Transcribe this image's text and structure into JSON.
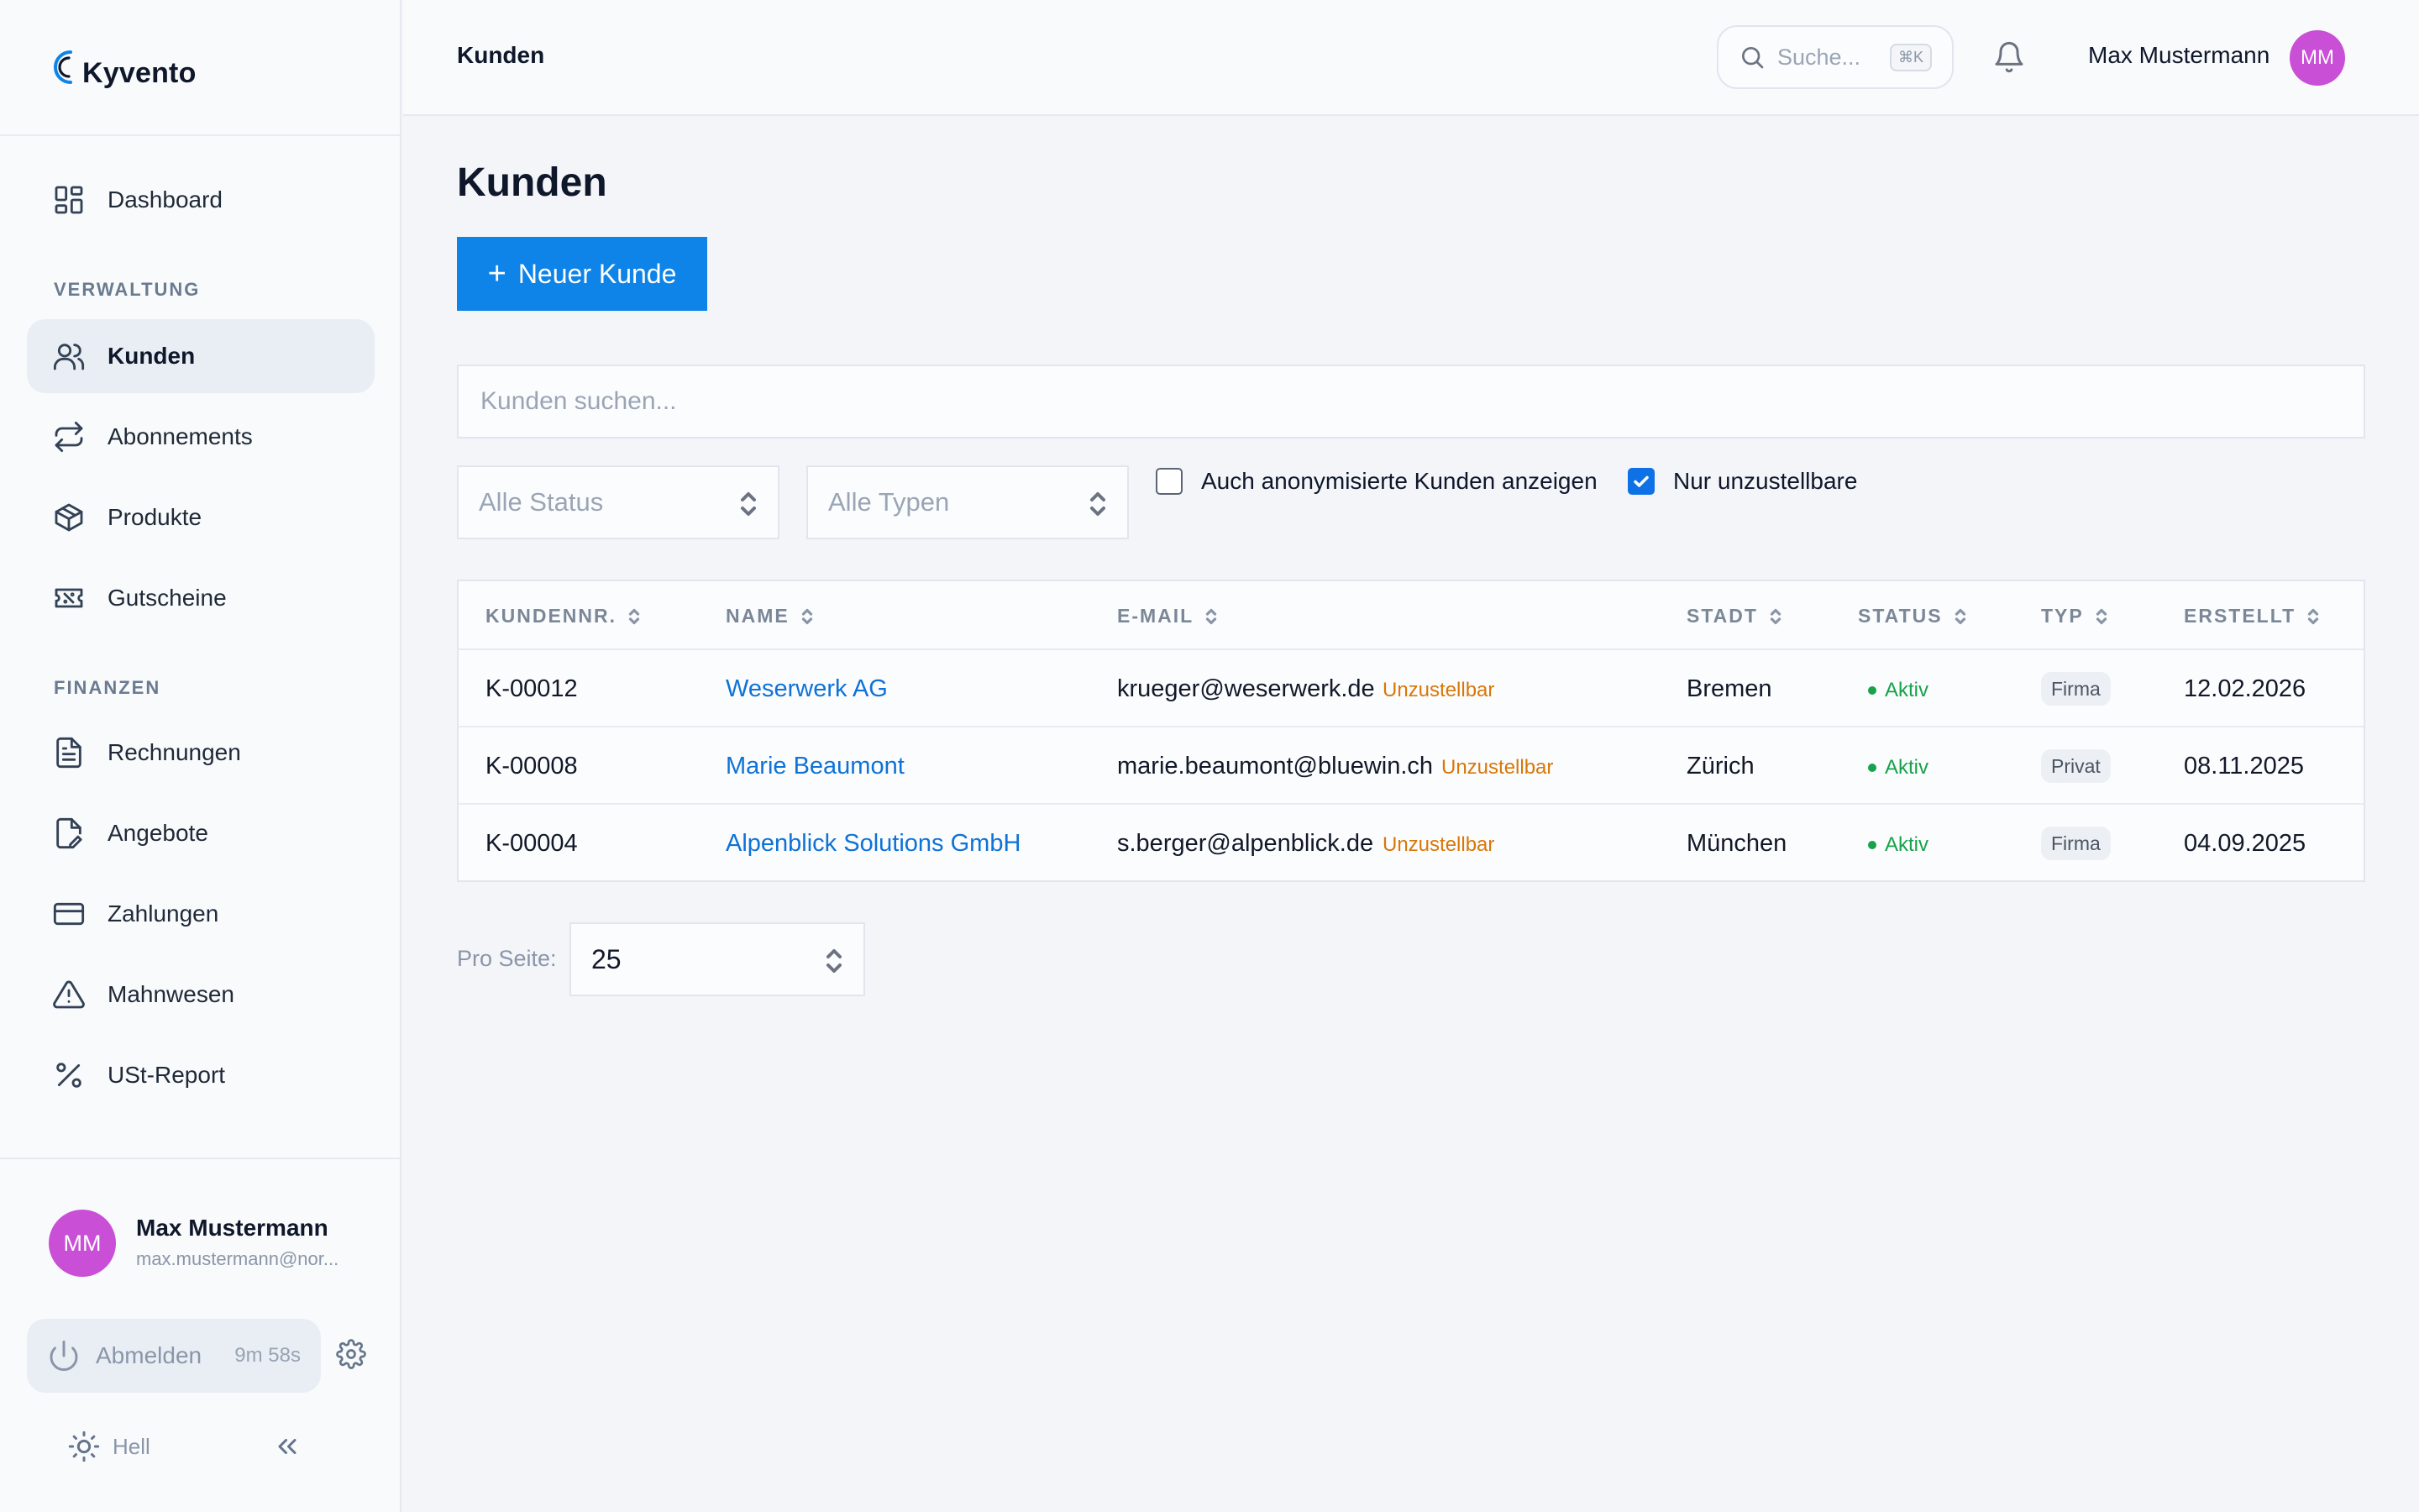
{
  "app": {
    "logo_text": "Kyvento"
  },
  "sidebar": {
    "dashboard": "Dashboard",
    "section_verwaltung": "VERWALTUNG",
    "kunden": "Kunden",
    "abonnements": "Abonnements",
    "produkte": "Produkte",
    "gutscheine": "Gutscheine",
    "section_finanzen": "FINANZEN",
    "rechnungen": "Rechnungen",
    "angebote": "Angebote",
    "zahlungen": "Zahlungen",
    "mahnwesen": "Mahnwesen",
    "ust_report": "USt-Report",
    "user": {
      "initials": "MM",
      "name": "Max Mustermann",
      "email": "max.mustermann@nor..."
    },
    "logout_label": "Abmelden",
    "logout_timer": "9m 58s",
    "theme_label": "Hell"
  },
  "topbar": {
    "breadcrumb": "Kunden",
    "search_placeholder": "Suche...",
    "search_shortcut": "⌘K",
    "user_name": "Max Mustermann",
    "user_initials": "MM"
  },
  "main": {
    "title": "Kunden",
    "new_button": "Neuer Kunde",
    "search_placeholder": "Kunden suchen...",
    "filter_status": "Alle Status",
    "filter_types": "Alle Typen",
    "checkbox_anonymized": {
      "label": "Auch anonymisierte Kunden anzeigen",
      "checked": false
    },
    "checkbox_undeliverable": {
      "label": "Nur unzustellbare",
      "checked": true
    },
    "table": {
      "headers": {
        "number": "KUNDENNR.",
        "name": "NAME",
        "email": "E-MAIL",
        "city": "STADT",
        "status": "STATUS",
        "type": "TYP",
        "created": "ERSTELLT"
      },
      "rows": [
        {
          "number": "K-00012",
          "name": "Weserwerk AG",
          "email": "krueger@weserwerk.de",
          "email_flag": "Unzustellbar",
          "city": "Bremen",
          "status": "Aktiv",
          "type": "Firma",
          "created": "12.02.2026"
        },
        {
          "number": "K-00008",
          "name": "Marie Beaumont",
          "email": "marie.beaumont@bluewin.ch",
          "email_flag": "Unzustellbar",
          "city": "Zürich",
          "status": "Aktiv",
          "type": "Privat",
          "created": "08.11.2025"
        },
        {
          "number": "K-00004",
          "name": "Alpenblick Solutions GmbH",
          "email": "s.berger@alpenblick.de",
          "email_flag": "Unzustellbar",
          "city": "München",
          "status": "Aktiv",
          "type": "Firma",
          "created": "04.09.2025"
        }
      ]
    },
    "per_page_label": "Pro Seite:",
    "per_page_value": "25"
  },
  "colors": {
    "primary": "#0e84e8",
    "link": "#0e72d6",
    "avatar": "#c94fd6",
    "warning": "#d97706",
    "success": "#16a34a"
  }
}
